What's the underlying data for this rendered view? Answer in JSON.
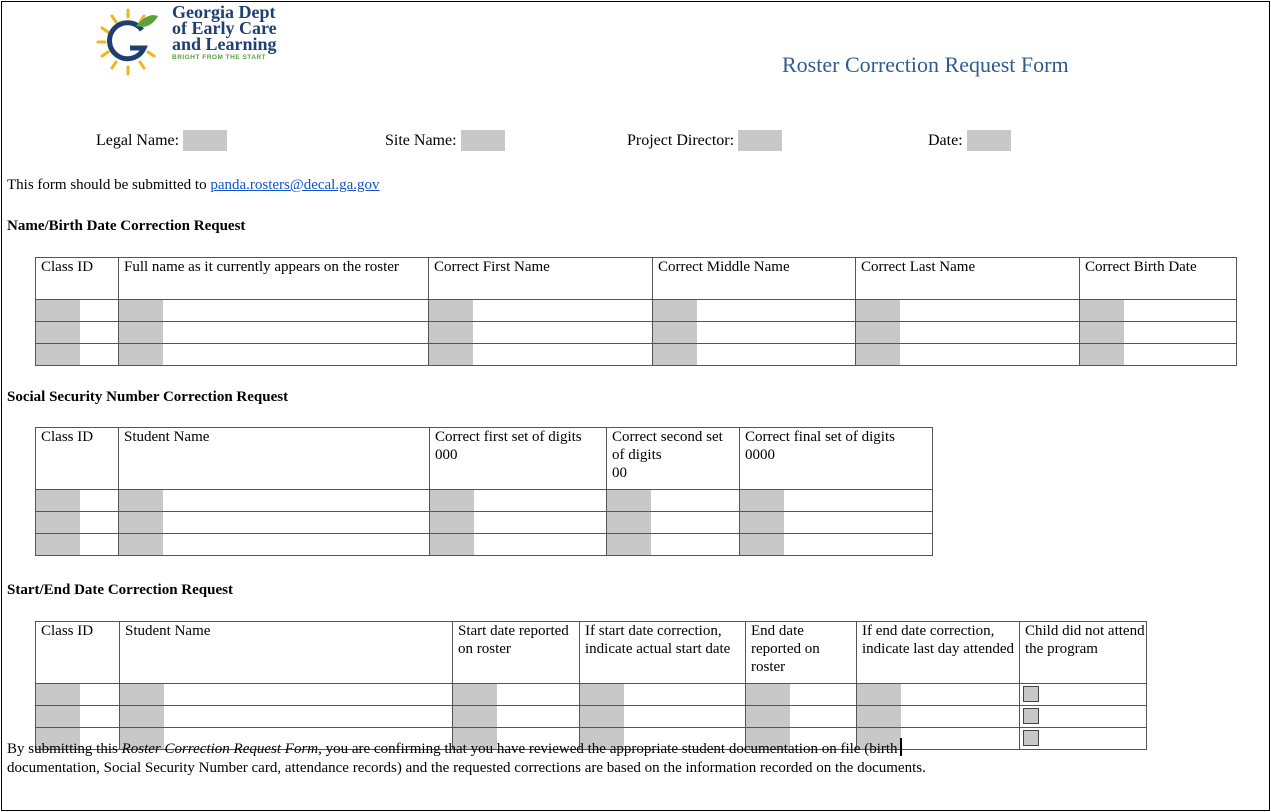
{
  "logo": {
    "line1": "Georgia Dept",
    "line2": "of Early Care",
    "line3": "and Learning",
    "tagline": "BRIGHT FROM THE START"
  },
  "form_title": "Roster Correction Request Form",
  "header_fields": [
    {
      "label": "Legal Name:"
    },
    {
      "label": "Site Name:"
    },
    {
      "label": "Project Director:"
    },
    {
      "label": "Date:"
    }
  ],
  "submit": {
    "prefix": "This form should be submitted to ",
    "email": "panda.rosters@decal.ga.gov"
  },
  "name_section": {
    "title": "Name/Birth Date Correction Request",
    "headers": [
      "Class ID",
      "Full name as it currently appears on the roster",
      "Correct First Name",
      "Correct Middle Name",
      "Correct Last Name",
      "Correct Birth Date"
    ]
  },
  "ssn_section": {
    "title": "Social Security Number Correction Request",
    "headers": [
      "Class ID",
      "Student Name",
      "Correct first set of digits",
      "Correct second set of digits",
      "Correct final set of digits"
    ],
    "masks": [
      "000",
      "00",
      "0000"
    ]
  },
  "date_section": {
    "title": "Start/End Date Correction Request",
    "headers": [
      "Class ID",
      "Student Name",
      "Start date reported on roster",
      "If start date correction, indicate actual start date",
      "End date reported on roster",
      "If end date correction, indicate last day attended",
      "Child did not attend the program"
    ]
  },
  "footer": {
    "part1": "By submitting this ",
    "italic": "Roster Correction Request Form",
    "part2": ", you are confirming that you have reviewed the appropriate student documentation on file (birth",
    "line2": "documentation, Social Security Number card, attendance records) and the requested corrections are based on the information recorded on the documents."
  }
}
